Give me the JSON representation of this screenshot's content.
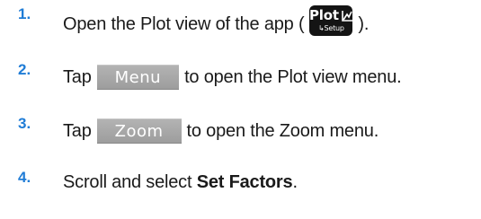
{
  "steps": [
    {
      "number": "1.",
      "before": "Open the Plot view of the app (",
      "key": {
        "label": "Plot",
        "icon": "plot-graph-icon",
        "sub": "↳Setup"
      },
      "after": ")."
    },
    {
      "number": "2.",
      "before": "Tap",
      "button": "Menu",
      "after": "to open the Plot view menu."
    },
    {
      "number": "3.",
      "before": "Tap",
      "button": "Zoom",
      "after": "to open the Zoom menu."
    },
    {
      "number": "4.",
      "before": "Scroll and select ",
      "bold": "Set Factors",
      "after": "."
    }
  ],
  "colors": {
    "step_number": "#1f7cd6",
    "softkey_bg": "#a8a8a8",
    "hardware_key_bg": "#141414"
  }
}
